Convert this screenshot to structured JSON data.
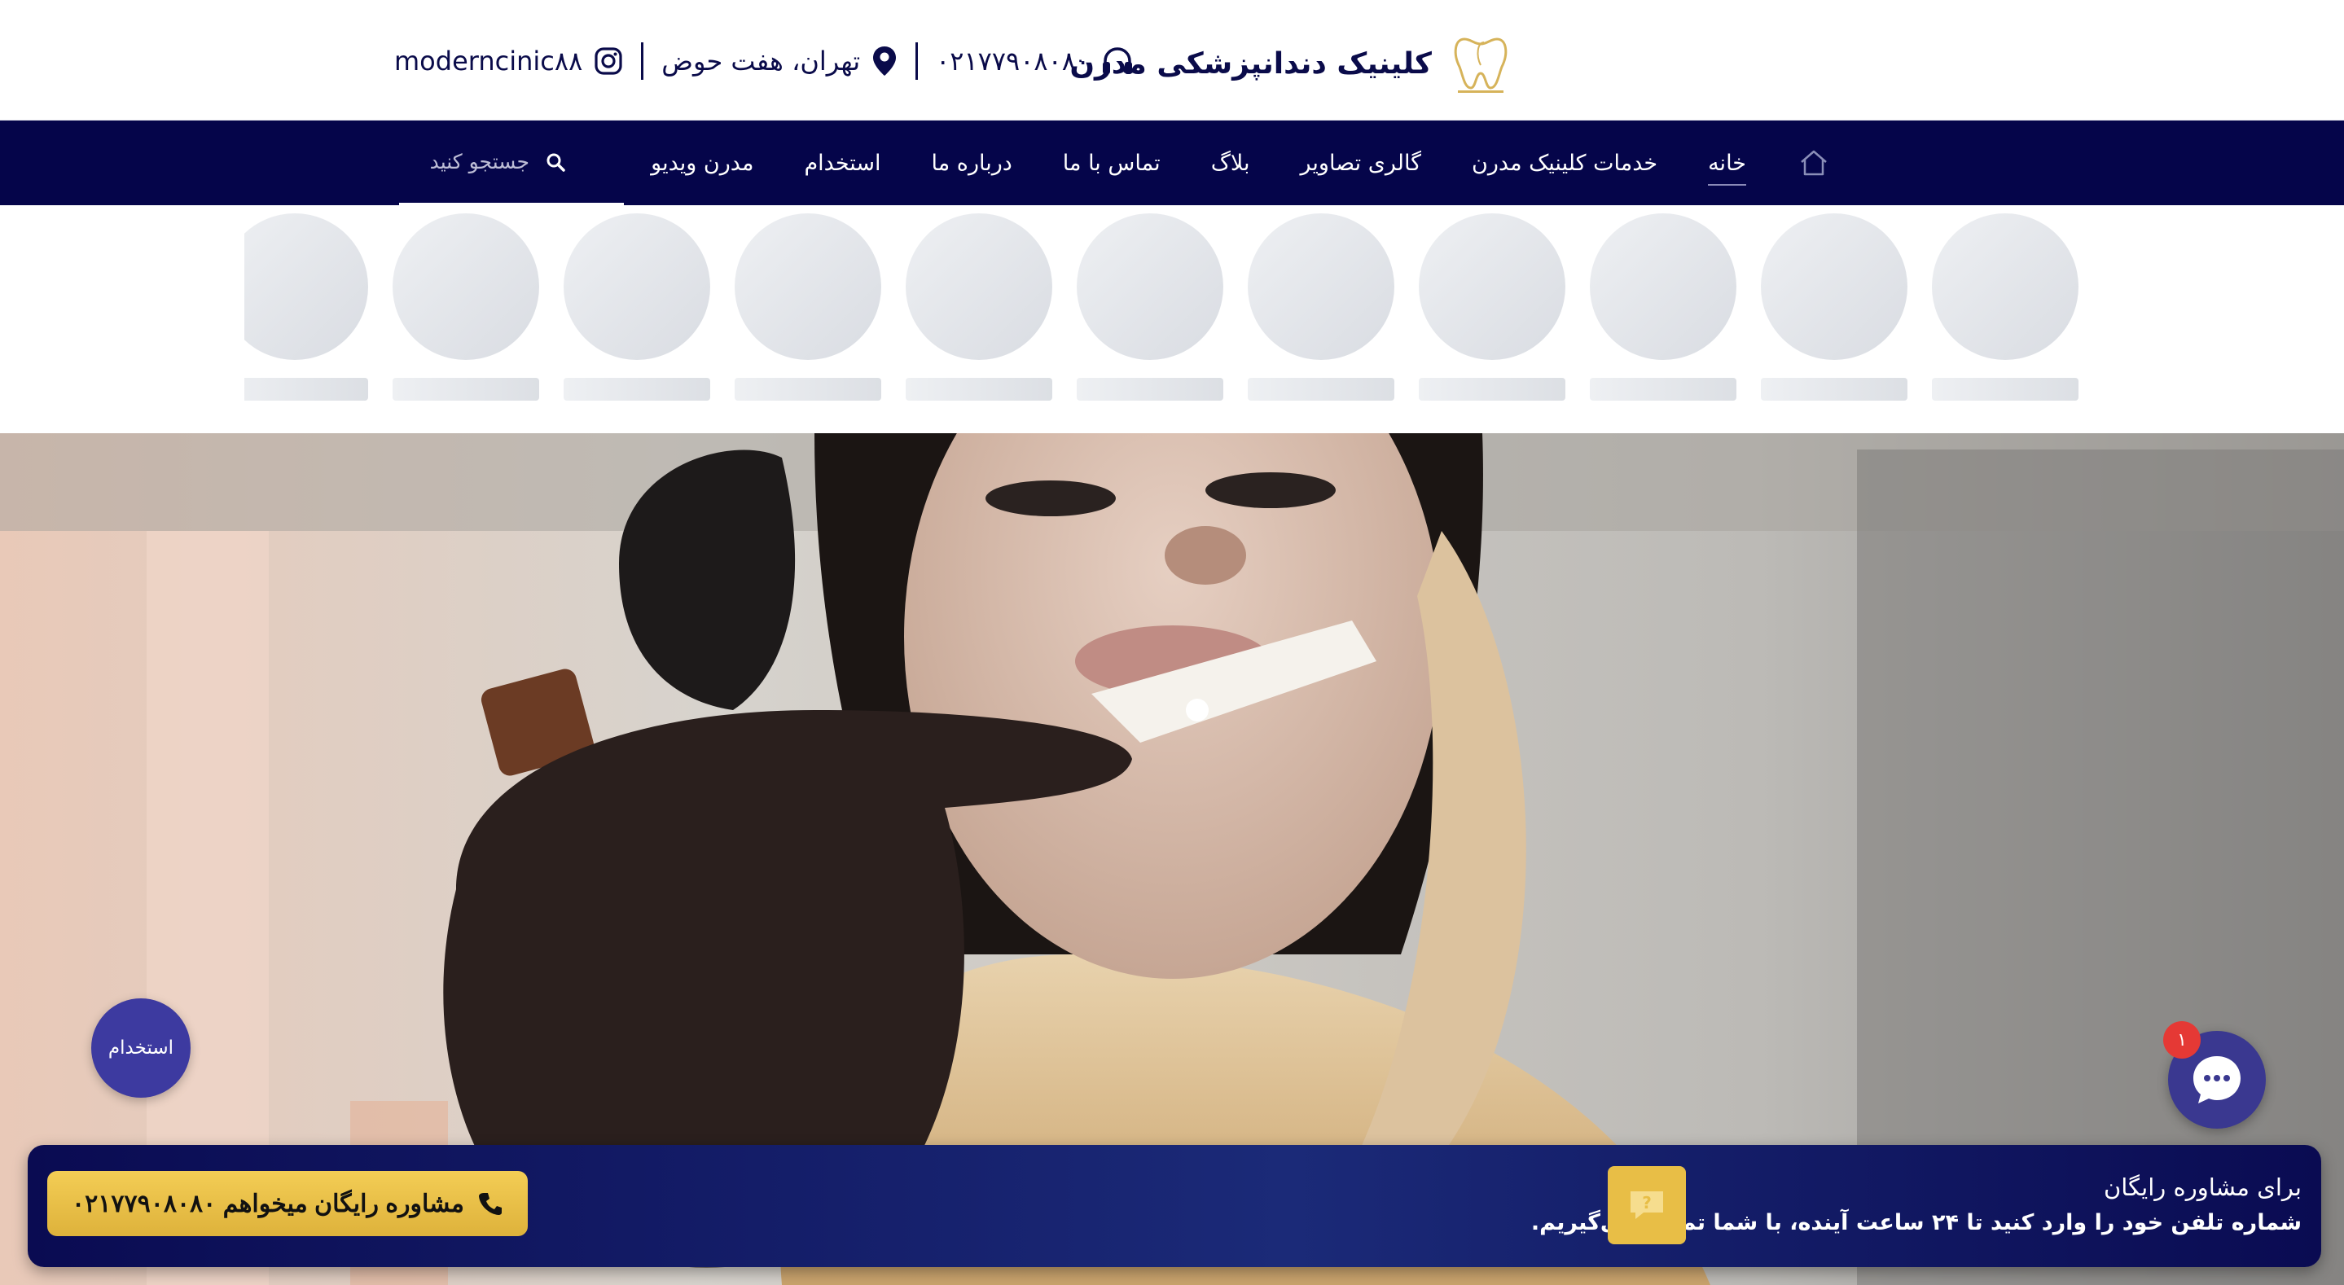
{
  "header": {
    "brand_title": "کلینیک دندانپزشکی مدرن",
    "phone": "۰۲۱۷۷۹۰۸۰۸۰",
    "address": "تهران، هفت حوض",
    "instagram": "moderncinic۸۸"
  },
  "nav": {
    "items": [
      {
        "label": "خانه"
      },
      {
        "label": "خدمات کلینیک مدرن"
      },
      {
        "label": "گالری تصاویر"
      },
      {
        "label": "بلاگ"
      },
      {
        "label": "تماس با ما"
      },
      {
        "label": "درباره ما"
      },
      {
        "label": "استخدام"
      },
      {
        "label": "مدرن ویدیو"
      }
    ],
    "search_placeholder": "جستجو کنید"
  },
  "floating": {
    "job_label": "استخدام",
    "chat_badge": "۱"
  },
  "consult": {
    "title": "برای مشاوره رایگان",
    "subtitle": "شماره تلفن خود را وارد کنید تا ۲۴ ساعت آینده، با شما تماس می‌گیریم.",
    "button_label": "مشاوره رایگان میخواهم ۰۲۱۷۷۹۰۸۰۸۰"
  },
  "colors": {
    "navy": "#05054a",
    "accent_gold": "#e8be46",
    "bubble_purple": "#3d3aa0"
  }
}
